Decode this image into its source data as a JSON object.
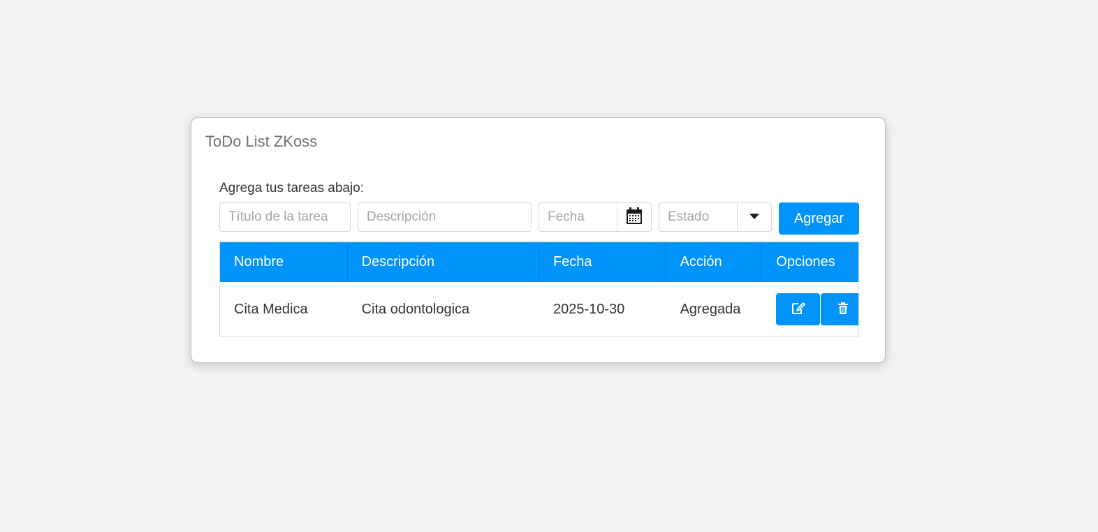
{
  "window": {
    "title": "ToDo List ZKoss"
  },
  "form": {
    "intro_label": "Agrega tus tareas abajo:",
    "title_placeholder": "Título de la tarea",
    "description_placeholder": "Descripción",
    "date_placeholder": "Fecha",
    "status_placeholder": "Estado",
    "add_label": "Agregar",
    "date_button_icon": "calendar-icon",
    "status_button_icon": "chevron-down-icon"
  },
  "table": {
    "headers": [
      "Nombre",
      "Descripción",
      "Fecha",
      "Acción",
      "Opciones"
    ],
    "rows": [
      {
        "name": "Cita Medica",
        "description": "Cita odontologica",
        "date": "2025-10-30",
        "action": "Agregada",
        "options": [
          "edit-icon",
          "trash-icon"
        ]
      }
    ]
  },
  "colors": {
    "accent": "#0093f9",
    "background": "#f2f2f2"
  }
}
